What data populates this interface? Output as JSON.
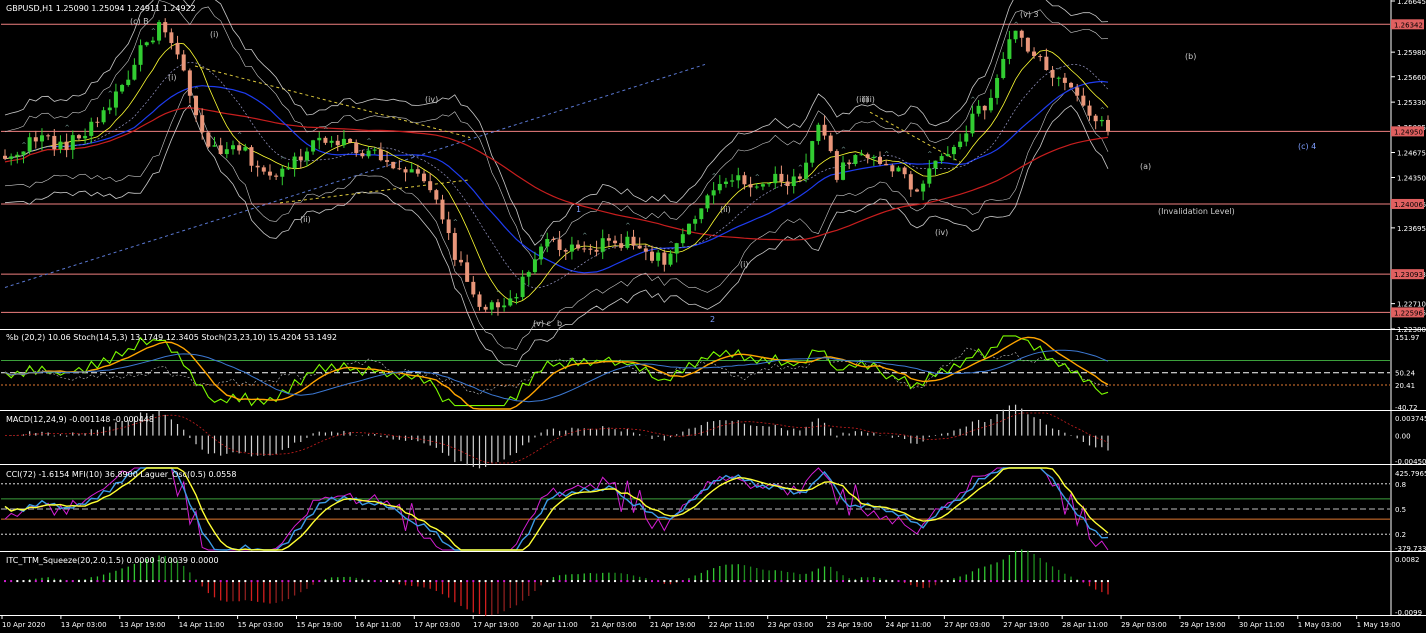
{
  "chart_data": {
    "type": "line",
    "symbol_header": "GBPUSD,H1  1.25090 1.25094 1.24911 1.24922",
    "main": {
      "y_ticks": [
        "1.26645",
        "1.25980",
        "1.25660",
        "1.25330",
        "1.25005",
        "1.24675",
        "1.24350",
        "1.24006",
        "1.23695",
        "1.23093",
        "1.22710",
        "1.22596",
        "1.22380"
      ],
      "ylim": [
        1.2238,
        1.26645
      ],
      "price_box_labels": [
        "1.26342",
        "1.24950",
        "1.24006",
        "1.23093",
        "1.22596"
      ],
      "hlines": [
        1.26342,
        1.2495,
        1.24006,
        1.23093,
        1.22596
      ],
      "annotation": "(Invalidation Level)",
      "wave_labels": [
        "(c) B",
        "(i)",
        "(ii)",
        "(iii)",
        "(iv)",
        "(v) c",
        "b",
        "1",
        "2",
        "(ii)",
        "(iii)",
        "(iv)",
        "(v) 3",
        "(b)",
        "(c) 4",
        "(a)",
        "(i)",
        "(i)"
      ],
      "series": [
        {
          "name": "price",
          "values": [
            1.2455,
            1.2478,
            1.2488,
            1.2472,
            1.2491,
            1.2518,
            1.2552,
            1.2598,
            1.2634,
            1.2586,
            1.2501,
            1.2461,
            1.2476,
            1.2452,
            1.2432,
            1.2458,
            1.2484,
            1.249,
            1.2469,
            1.2472,
            1.2455,
            1.244,
            1.2418,
            1.2352,
            1.2288,
            1.2262,
            1.2275,
            1.2305,
            1.2358,
            1.234,
            1.2336,
            1.235,
            1.2352,
            1.2342,
            1.2327,
            1.2355,
            1.2392,
            1.2431,
            1.2438,
            1.242,
            1.2434,
            1.243,
            1.2508,
            1.244,
            1.2459,
            1.2462,
            1.2447,
            1.242,
            1.2452,
            1.2478,
            1.251,
            1.254,
            1.2625,
            1.26,
            1.2572,
            1.255,
            1.252,
            1.2492
          ]
        }
      ]
    },
    "stoch": {
      "header": "%b (20,2) 10.06  Stoch(14,5,3) 13.1749 12.3405  Stoch(23,23,10) 15.4204 53.1492",
      "y_ticks": [
        "151.97",
        "50.24",
        "20.41",
        "-40.72"
      ],
      "ylim": [
        -40.72,
        151.97
      ]
    },
    "macd": {
      "header": "MACD(12,24,9) -0.001148 -0.000448",
      "y_ticks": [
        "0.003745",
        "0.00",
        "-0.004504"
      ],
      "ylim": [
        -0.004504,
        0.003745
      ]
    },
    "cci": {
      "header": "CCI(72) -1.6154  MFI(10) 36.8900  Laguer_Osc(0.5) 0.0558",
      "y_ticks": [
        "425.7965",
        "0.8",
        "0.5",
        "0.2",
        "-379.7331"
      ],
      "ylim": [
        -379.7331,
        425.7965
      ]
    },
    "squeeze": {
      "header": "ITC_TTM_Squeeze(20,2.0,1.5) 0.0000 -0.0039 0.0000",
      "y_ticks": [
        "0.0082",
        "-0.0099"
      ],
      "ylim": [
        -0.0099,
        0.0082
      ]
    },
    "x_tick_labels": [
      "10 Apr 2020",
      "13 Apr 03:00",
      "13 Apr 19:00",
      "14 Apr 11:00",
      "15 Apr 03:00",
      "15 Apr 19:00",
      "16 Apr 11:00",
      "17 Apr 03:00",
      "17 Apr 19:00",
      "20 Apr 11:00",
      "21 Apr 03:00",
      "21 Apr 19:00",
      "22 Apr 11:00",
      "23 Apr 03:00",
      "23 Apr 19:00",
      "24 Apr 11:00",
      "27 Apr 03:00",
      "27 Apr 19:00",
      "28 Apr 11:00",
      "29 Apr 03:00",
      "29 Apr 19:00",
      "30 Apr 11:00",
      "1 May 03:00",
      "1 May 19:00"
    ],
    "colors": {
      "up_candle": "#32CD32",
      "down_candle": "#E9967A",
      "hline": "#F08080",
      "price_box": "#E06060",
      "ma_red": "#C81E1E",
      "ma_blue": "#1E3CF0",
      "bollinger": "#C8C8C8",
      "green_line": "#7CFC00",
      "orange_line": "#FFA500",
      "yellow_line": "#FFFF32",
      "magenta_line": "#D21ED2"
    }
  }
}
